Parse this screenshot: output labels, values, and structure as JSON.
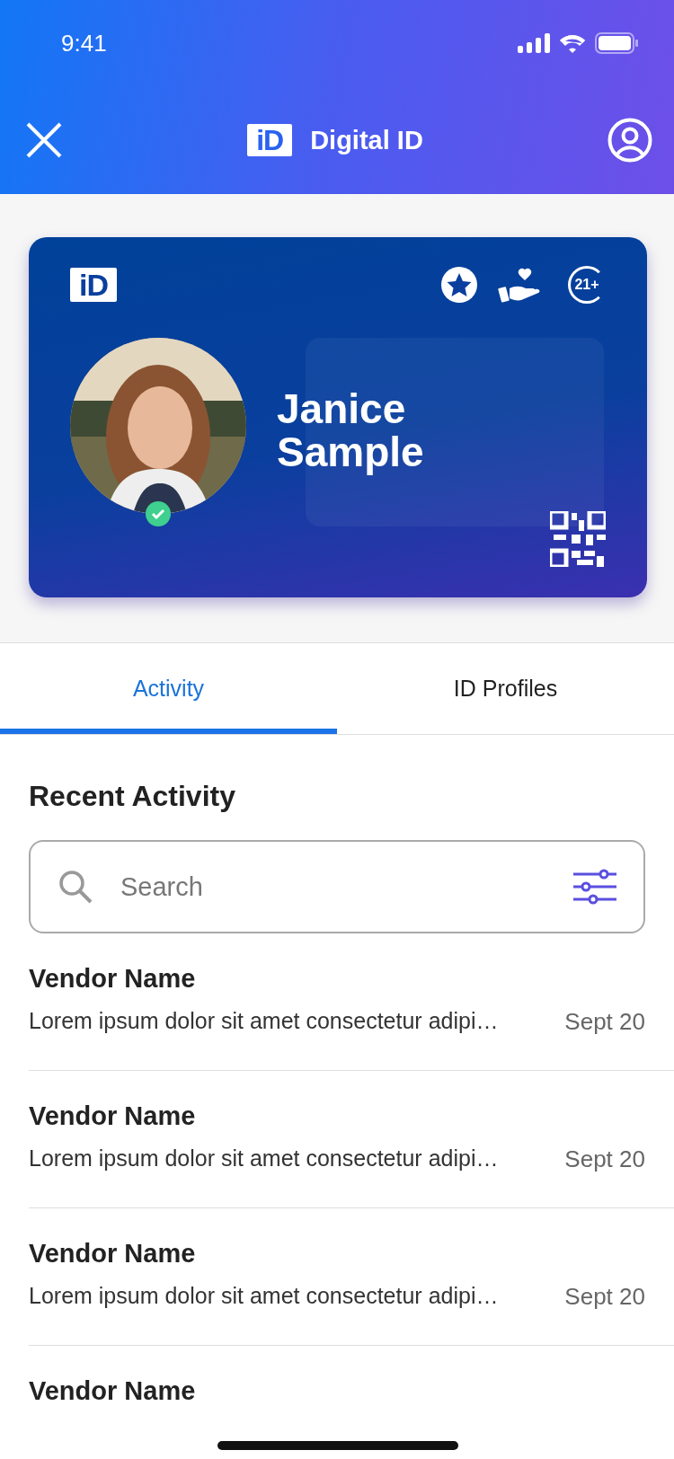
{
  "status_bar": {
    "time": "9:41"
  },
  "header": {
    "logo": "iD",
    "title": "Digital ID"
  },
  "card": {
    "logo": "iD",
    "badge": "21+",
    "name_first": "Janice",
    "name_last": "Sample",
    "verified": true
  },
  "tabs": [
    {
      "label": "Activity",
      "selected": true
    },
    {
      "label": "ID Profiles",
      "selected": false
    }
  ],
  "section_title": "Recent Activity",
  "search": {
    "placeholder": "Search"
  },
  "activity": [
    {
      "vendor": "Vendor Name",
      "description": "Lorem ipsum dolor sit amet consectetur adipi…",
      "date": "Sept 20"
    },
    {
      "vendor": "Vendor Name",
      "description": "Lorem ipsum dolor sit amet consectetur adipi…",
      "date": "Sept 20"
    },
    {
      "vendor": "Vendor Name",
      "description": "Lorem ipsum dolor sit amet consectetur adipi…",
      "date": "Sept 20"
    },
    {
      "vendor": "Vendor Name"
    }
  ]
}
